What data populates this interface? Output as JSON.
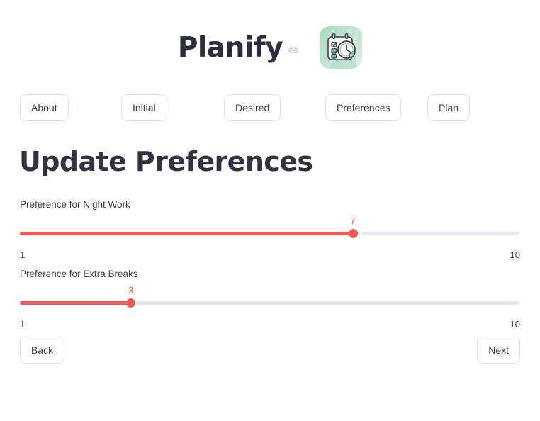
{
  "header": {
    "app_title": "Planify",
    "anchor_icon": "link-icon",
    "logo_icon": "calendar-clock-icon",
    "logo_colors": {
      "bg_from": "#a9ddc0",
      "bg_to": "#d9ece0",
      "ink": "#3a3f4a",
      "accent": "#6fc79b"
    }
  },
  "nav": {
    "items": [
      {
        "label": "About",
        "name": "about"
      },
      {
        "label": "Initial",
        "name": "initial"
      },
      {
        "label": "Desired",
        "name": "desired"
      },
      {
        "label": "Preferences",
        "name": "preferences"
      },
      {
        "label": "Plan",
        "name": "plan"
      }
    ]
  },
  "main": {
    "page_title": "Update Preferences",
    "sliders": [
      {
        "label": "Preference for Night Work",
        "value": 7,
        "min": 1,
        "max": 10,
        "min_label": "1",
        "max_label": "10",
        "value_label": "7"
      },
      {
        "label": "Preference for Extra Breaks",
        "value": 3,
        "min": 1,
        "max": 10,
        "min_label": "1",
        "max_label": "10",
        "value_label": "3"
      }
    ]
  },
  "footer": {
    "back_label": "Back",
    "next_label": "Next"
  },
  "colors": {
    "accent": "#f05a54",
    "track_inactive": "#e6e9ef",
    "text": "#31333f",
    "border": "#e0e1e6",
    "background": "#ffffff"
  }
}
